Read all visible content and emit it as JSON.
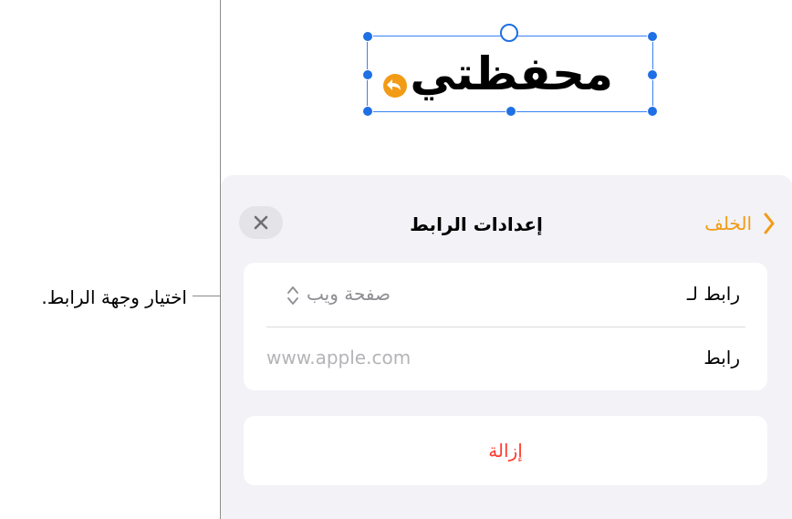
{
  "canvas": {
    "text_box_content": "محفظتي"
  },
  "panel": {
    "title": "إعدادات الرابط",
    "back_label": "الخلف",
    "link_to": {
      "label": "رابط لـ",
      "value": "صفحة ويب"
    },
    "link": {
      "label": "رابط",
      "placeholder": "www.apple.com"
    },
    "remove_label": "إزالة"
  },
  "callout": {
    "text": "اختيار وجهة الرابط."
  },
  "colors": {
    "accent": "#f29b16",
    "selection": "#1f6fe5",
    "destructive": "#ff3b30"
  }
}
